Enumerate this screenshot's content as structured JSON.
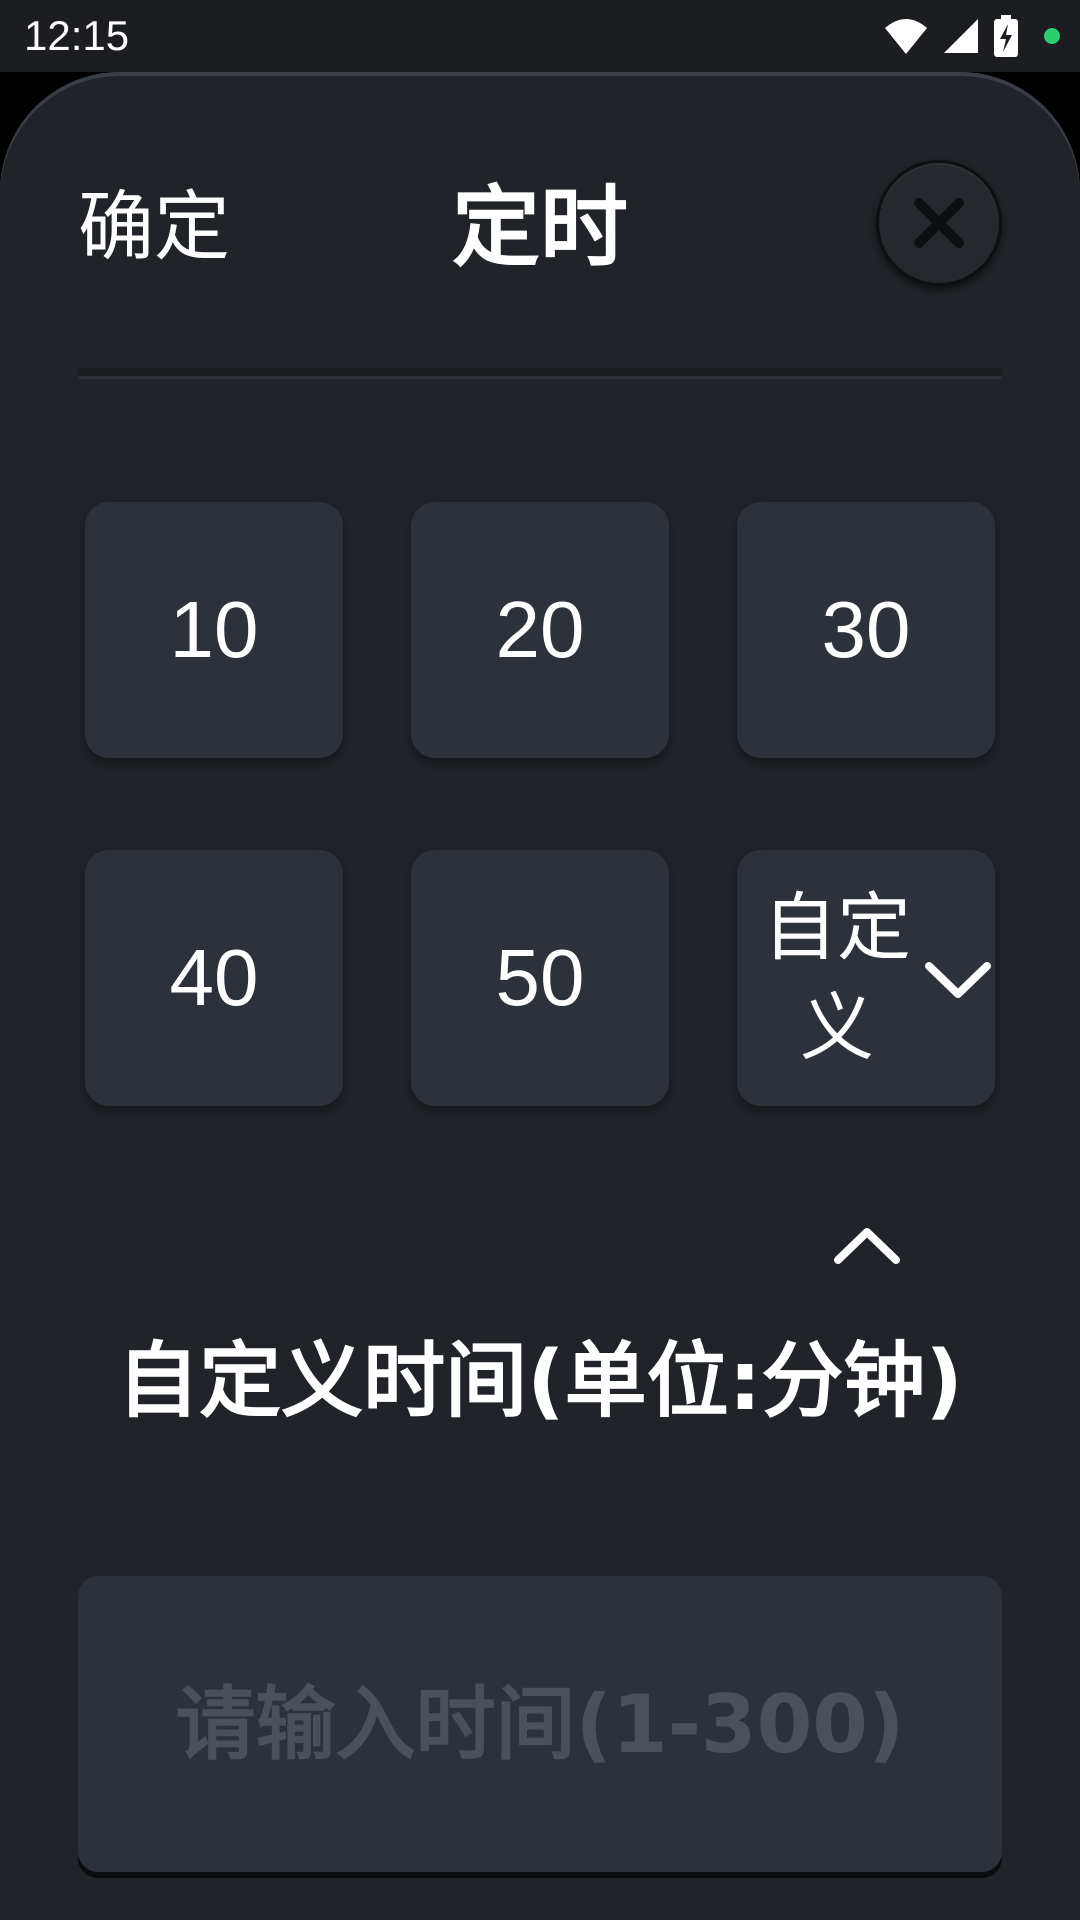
{
  "status_bar": {
    "time": "12:15",
    "icons": [
      "wifi-icon",
      "cellular-signal-icon",
      "battery-charging-icon",
      "notification-dot-icon"
    ],
    "dot_color": "#2ecc71"
  },
  "dialog": {
    "confirm_label": "确定",
    "title": "定时",
    "close_icon": "close-icon"
  },
  "presets": [
    "10",
    "20",
    "30",
    "40",
    "50"
  ],
  "custom_option": {
    "label": "自定义",
    "expand_icon": "chevron-down-icon",
    "collapse_icon": "chevron-up-icon"
  },
  "custom_section": {
    "label": "自定义时间(单位:分钟)",
    "input_value": "",
    "input_placeholder": "请输入时间(1-300)"
  },
  "colors": {
    "sheet_background": "#202328",
    "tile_background": "#2d3139",
    "text": "#ffffff",
    "placeholder": "#4c5058"
  }
}
